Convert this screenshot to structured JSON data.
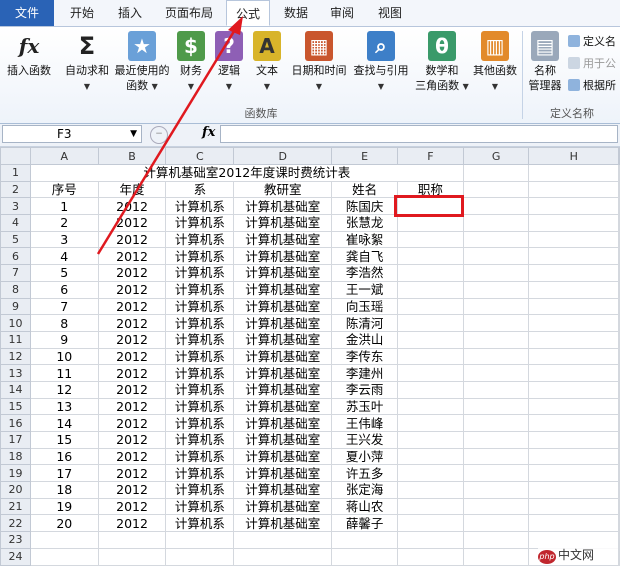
{
  "tabs": [
    {
      "label": "文件"
    },
    {
      "label": "开始"
    },
    {
      "label": "插入"
    },
    {
      "label": "页面布局"
    },
    {
      "label": "公式"
    },
    {
      "label": "数据"
    },
    {
      "label": "审阅"
    },
    {
      "label": "视图"
    }
  ],
  "ribbon": {
    "buttons": [
      {
        "label": "插入函数",
        "icon": "fx-icon"
      },
      {
        "label": "自动求和",
        "icon": "sigma-icon"
      },
      {
        "label": "最近使用的",
        "label2": "函数",
        "icon": "recent-book-icon"
      },
      {
        "label": "财务",
        "icon": "finance-book-icon"
      },
      {
        "label": "逻辑",
        "icon": "logic-book-icon"
      },
      {
        "label": "文本",
        "icon": "text-book-icon"
      },
      {
        "label": "日期和时间",
        "icon": "date-book-icon"
      },
      {
        "label": "查找与引用",
        "icon": "lookup-book-icon"
      },
      {
        "label": "数学和",
        "label2": "三角函数",
        "icon": "math-book-icon"
      },
      {
        "label": "其他函数",
        "icon": "more-books-icon"
      },
      {
        "label": "名称",
        "label2": "管理器",
        "icon": "name-manager-icon"
      }
    ],
    "group_label": "函数库",
    "defined_names_label": "定义名称",
    "small": [
      {
        "label": "定义名"
      },
      {
        "label": "用于公"
      },
      {
        "label": "根据所"
      }
    ]
  },
  "formula_bar": {
    "name_box": "F3",
    "fx": "fx",
    "value": ""
  },
  "columns": [
    "A",
    "B",
    "C",
    "D",
    "E",
    "F",
    "G",
    "H"
  ],
  "sheet": {
    "title": "计算机基础室2012年度课时费统计表",
    "headers": [
      "序号",
      "年度",
      "系",
      "教研室",
      "姓名",
      "职称"
    ],
    "rows": [
      [
        "1",
        "2012",
        "计算机系",
        "计算机基础室",
        "陈国庆"
      ],
      [
        "2",
        "2012",
        "计算机系",
        "计算机基础室",
        "张慧龙"
      ],
      [
        "3",
        "2012",
        "计算机系",
        "计算机基础室",
        "崔咏絮"
      ],
      [
        "4",
        "2012",
        "计算机系",
        "计算机基础室",
        "龚自飞"
      ],
      [
        "5",
        "2012",
        "计算机系",
        "计算机基础室",
        "李浩然"
      ],
      [
        "6",
        "2012",
        "计算机系",
        "计算机基础室",
        "王一斌"
      ],
      [
        "7",
        "2012",
        "计算机系",
        "计算机基础室",
        "向玉瑶"
      ],
      [
        "8",
        "2012",
        "计算机系",
        "计算机基础室",
        "陈清河"
      ],
      [
        "9",
        "2012",
        "计算机系",
        "计算机基础室",
        "金洪山"
      ],
      [
        "10",
        "2012",
        "计算机系",
        "计算机基础室",
        "李传东"
      ],
      [
        "11",
        "2012",
        "计算机系",
        "计算机基础室",
        "李建州"
      ],
      [
        "12",
        "2012",
        "计算机系",
        "计算机基础室",
        "李云雨"
      ],
      [
        "13",
        "2012",
        "计算机系",
        "计算机基础室",
        "苏玉叶"
      ],
      [
        "14",
        "2012",
        "计算机系",
        "计算机基础室",
        "王伟峰"
      ],
      [
        "15",
        "2012",
        "计算机系",
        "计算机基础室",
        "王兴发"
      ],
      [
        "16",
        "2012",
        "计算机系",
        "计算机基础室",
        "夏小萍"
      ],
      [
        "17",
        "2012",
        "计算机系",
        "计算机基础室",
        "许五多"
      ],
      [
        "18",
        "2012",
        "计算机系",
        "计算机基础室",
        "张定海"
      ],
      [
        "19",
        "2012",
        "计算机系",
        "计算机基础室",
        "蒋山农"
      ],
      [
        "20",
        "2012",
        "计算机系",
        "计算机基础室",
        "薛馨子"
      ]
    ]
  },
  "watermark": {
    "badge": "php",
    "text": "中文网"
  },
  "colors": {
    "file_tab": "#2a63b6",
    "annotation": "#e0191f"
  }
}
